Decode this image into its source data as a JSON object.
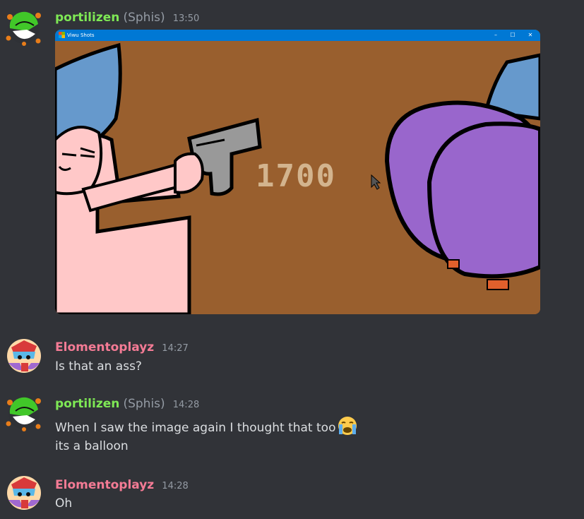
{
  "messages": [
    {
      "username": "portilizen",
      "nickname": "(Sphis)",
      "timestamp": "13:50",
      "username_color": "#7ee855"
    },
    {
      "username": "Elomentoplayz",
      "timestamp": "14:27",
      "username_color": "#f47b95",
      "text": "Is that an ass?"
    },
    {
      "username": "portilizen",
      "nickname": "(Sphis)",
      "timestamp": "14:28",
      "username_color": "#7ee855",
      "lines": [
        "When I saw the image again I thought that too",
        "its a balloon"
      ],
      "emoji": "loudly-crying-face"
    },
    {
      "username": "Elomentoplayz",
      "timestamp": "14:28",
      "username_color": "#f47b95",
      "text": "Oh"
    }
  ],
  "embed": {
    "window_title": "Viwu Shots",
    "score": "1700",
    "background_color": "#995f2e",
    "titlebar_color": "#0078d4",
    "window_buttons": [
      "–",
      "☐",
      "✕"
    ]
  }
}
